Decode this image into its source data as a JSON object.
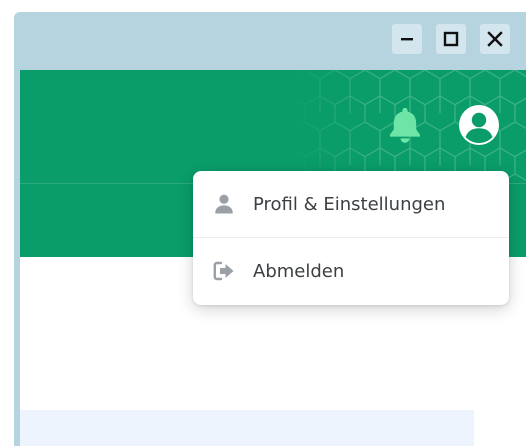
{
  "window": {
    "controls": [
      {
        "name": "minimize",
        "icon": "minimize-icon"
      },
      {
        "name": "maximize",
        "icon": "maximize-icon"
      },
      {
        "name": "close",
        "icon": "close-icon"
      }
    ]
  },
  "header": {
    "notifications_icon": "bell-icon",
    "account_icon": "user-circle-icon"
  },
  "user_menu": {
    "items": [
      {
        "label": "Profil & Einstellungen",
        "icon": "user-icon"
      },
      {
        "label": "Abmelden",
        "icon": "sign-out-icon"
      }
    ]
  },
  "colors": {
    "window_frame": "#b5d4e0",
    "header_green": "#0a9d69",
    "bell": "#6ee4a6",
    "menu_text": "#3c4043",
    "menu_icon": "#9aa0a6",
    "content_strip": "#eef4fd"
  }
}
